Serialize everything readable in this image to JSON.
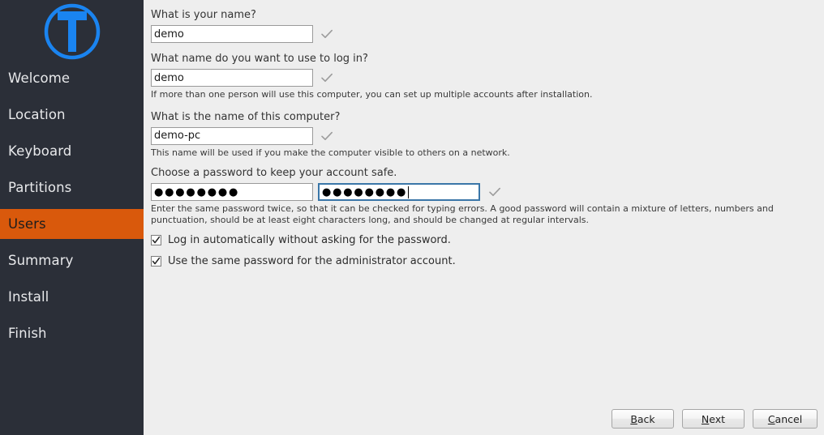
{
  "colors": {
    "sidebar_bg": "#2b2f38",
    "sidebar_active_bg": "#d9590c",
    "panel_bg": "#eeeeee",
    "logo_blue": "#1a84f0",
    "focus_border": "#3a76a8"
  },
  "sidebar": {
    "logo_letter": "T",
    "logo_name": "installer-logo",
    "items": [
      {
        "label": "Welcome",
        "active": false
      },
      {
        "label": "Location",
        "active": false
      },
      {
        "label": "Keyboard",
        "active": false
      },
      {
        "label": "Partitions",
        "active": false
      },
      {
        "label": "Users",
        "active": true
      },
      {
        "label": "Summary",
        "active": false
      },
      {
        "label": "Install",
        "active": false
      },
      {
        "label": "Finish",
        "active": false
      }
    ]
  },
  "form": {
    "name": {
      "label": "What is your name?",
      "value": "demo",
      "valid": true
    },
    "login": {
      "label": "What name do you want to use to log in?",
      "value": "demo",
      "valid": true,
      "hint": "If more than one person will use this computer, you can set up multiple accounts after installation."
    },
    "hostname": {
      "label": "What is the name of this computer?",
      "value": "demo-pc",
      "valid": true,
      "hint": "This name will be used if you make the computer visible to others on a network."
    },
    "password": {
      "label": "Choose a password to keep your account safe.",
      "value": "●●●●●●●●",
      "repeat_value": "●●●●●●●●",
      "repeat_focused": true,
      "valid": true,
      "hint": "Enter the same password twice, so that it can be checked for typing errors. A good password will contain a mixture of letters, numbers and punctuation, should be at least eight characters long, and should be changed at regular intervals."
    },
    "checkboxes": [
      {
        "label": "Log in automatically without asking for the password.",
        "checked": true
      },
      {
        "label": "Use the same password for the administrator account.",
        "checked": true
      }
    ]
  },
  "buttons": {
    "back": {
      "pre": "",
      "mnemonic": "B",
      "post": "ack"
    },
    "next": {
      "pre": "",
      "mnemonic": "N",
      "post": "ext"
    },
    "cancel": {
      "pre": "",
      "mnemonic": "C",
      "post": "ancel"
    }
  }
}
